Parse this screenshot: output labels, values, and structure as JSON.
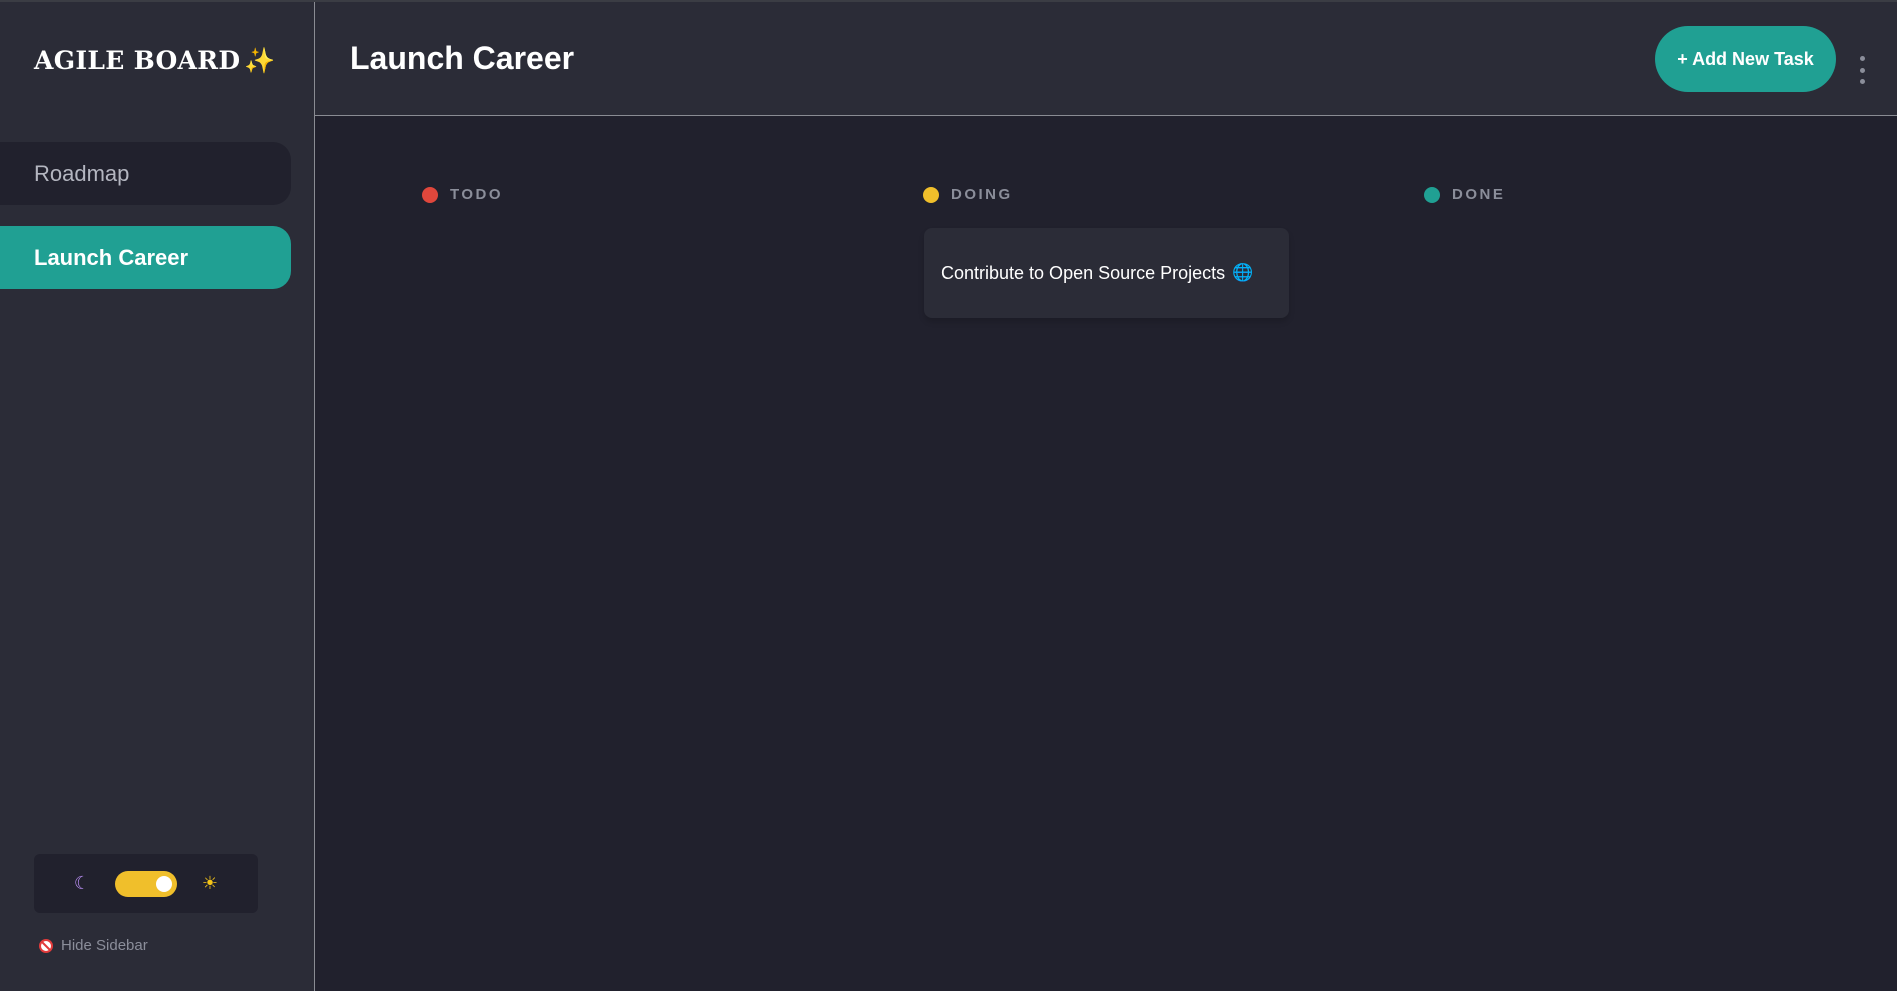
{
  "brand": {
    "title": "AGILE BOARD",
    "icon": "✨"
  },
  "sidebar": {
    "items": [
      {
        "label": "Roadmap"
      },
      {
        "label": "Launch Career"
      }
    ],
    "theme": {
      "dark_icon": "☾",
      "light_icon": "☀",
      "mode": "light-on"
    },
    "hide_label": "Hide Sidebar"
  },
  "header": {
    "title": "Launch Career",
    "add_task_label": "+ Add New Task"
  },
  "columns": [
    {
      "name": "TODO",
      "color": "#e0473c"
    },
    {
      "name": "DOING",
      "color": "#f0bf2b"
    },
    {
      "name": "DONE",
      "color": "#20a093"
    }
  ],
  "tasks": [
    {
      "title": "Contribute to Open Source Projects",
      "icon": "🌐",
      "column": "DOING"
    }
  ],
  "colors": {
    "accent": "#20a093",
    "background": "#21212d",
    "panel": "#2b2c37"
  }
}
